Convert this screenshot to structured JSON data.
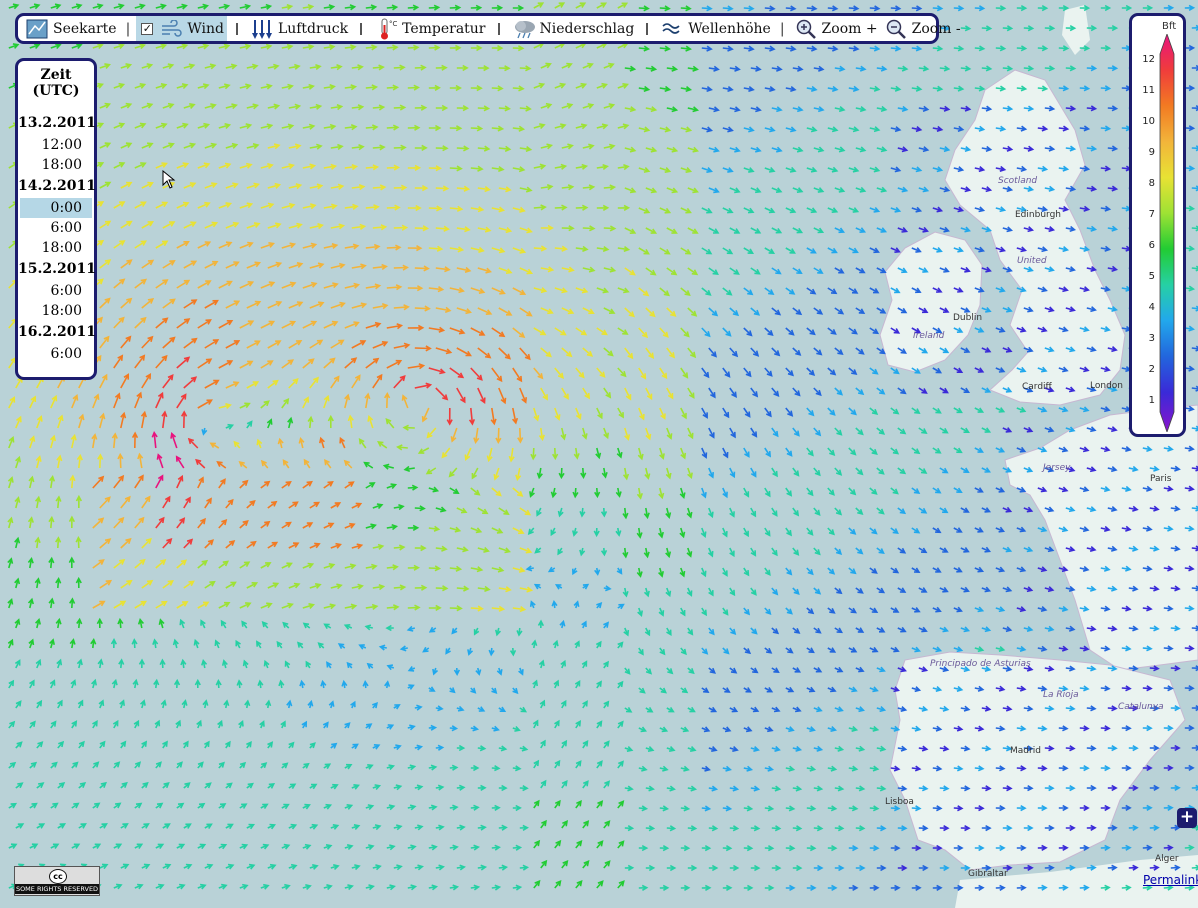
{
  "toolbar": {
    "seekarte": "Seekarte",
    "wind": "Wind",
    "luftdruck": "Luftdruck",
    "temperatur": "Temperatur",
    "niederschlag": "Niederschlag",
    "wellenhoehe": "Wellenhöhe",
    "zoom_in": "Zoom +",
    "zoom_out": "Zoom -",
    "separator": "|",
    "wind_checked": true
  },
  "timepanel": {
    "header": "Zeit (UTC)",
    "d1": "13.2.2011",
    "d1t1": "12:00",
    "d1t2": "18:00",
    "d2": "14.2.2011",
    "d2t1": "0:00",
    "d2t2": "6:00",
    "d2t3": "18:00",
    "d3": "15.2.2011",
    "d3t1": "6:00",
    "d3t2": "18:00",
    "d4": "16.2.2011",
    "d4t1": "6:00",
    "selected": "0:00"
  },
  "legend": {
    "unit": "Bft",
    "levels": [
      "12",
      "11",
      "10",
      "9",
      "8",
      "7",
      "6",
      "5",
      "4",
      "3",
      "2",
      "1"
    ],
    "colors": [
      "#e8137e",
      "#f03c3c",
      "#f27a22",
      "#f2b43a",
      "#e8e234",
      "#9ee234",
      "#22cc33",
      "#26d0a4",
      "#22a8ec",
      "#2266dd",
      "#3a2ad8",
      "#8a14cc"
    ]
  },
  "map_labels": {
    "scotland": "Scotland",
    "edinburgh": "Edinburgh",
    "united": "United",
    "dublin": "Dublin",
    "ireland": "Ireland",
    "cardiff": "Cardiff",
    "london": "London",
    "jersey": "Jersey",
    "paris": "Paris",
    "asturias": "Principado de Asturias",
    "larioja": "La Rioja",
    "catalunya": "Catalunya",
    "madrid": "Madrid",
    "lisboa": "Lisboa",
    "gibraltar": "Gibraltar",
    "alger": "Alger"
  },
  "cc_badge": "SOME RIGHTS RESERVED",
  "cc_symbol": "cc",
  "plus_button": "+",
  "permalink": "Permalink"
}
